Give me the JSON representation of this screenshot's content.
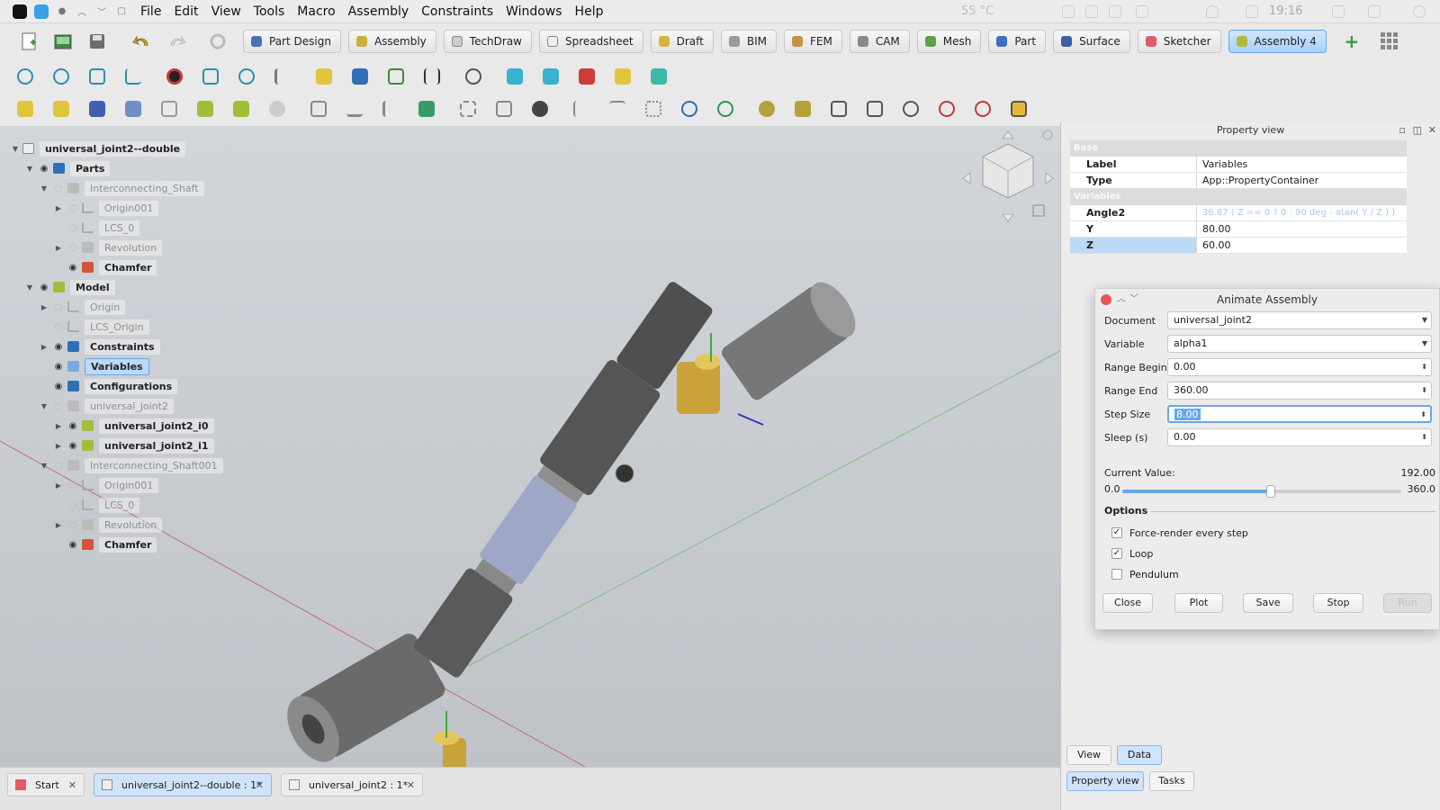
{
  "menubar": {
    "items": [
      "File",
      "Edit",
      "View",
      "Tools",
      "Macro",
      "Assembly",
      "Constraints",
      "Windows",
      "Help"
    ],
    "temperature": "55 °C",
    "time": "19:16"
  },
  "workbenches": [
    "Part Design",
    "Assembly",
    "TechDraw",
    "Spreadsheet",
    "Draft",
    "BIM",
    "FEM",
    "CAM",
    "Mesh",
    "Part",
    "Surface",
    "Sketcher",
    "Assembly 4"
  ],
  "active_workbench": "Assembly 4",
  "tree": {
    "rows": [
      {
        "label": "universal_joint2--double",
        "level": 0
      },
      {
        "label": "Parts",
        "level": 1
      },
      {
        "label": "Interconnecting_Shaft",
        "level": 2
      },
      {
        "label": "Origin001",
        "level": 3
      },
      {
        "label": "LCS_0",
        "level": 3
      },
      {
        "label": "Revolution",
        "level": 3
      },
      {
        "label": "Chamfer",
        "level": 3
      },
      {
        "label": "Model",
        "level": 1
      },
      {
        "label": "Origin",
        "level": 2
      },
      {
        "label": "LCS_Origin",
        "level": 2
      },
      {
        "label": "Constraints",
        "level": 2
      },
      {
        "label": "Variables",
        "level": 2
      },
      {
        "label": "Configurations",
        "level": 2
      },
      {
        "label": "universal_joint2",
        "level": 2
      },
      {
        "label": "universal_joint2_i0",
        "level": 3
      },
      {
        "label": "universal_joint2_i1",
        "level": 3
      },
      {
        "label": "Interconnecting_Shaft001",
        "level": 2
      },
      {
        "label": "Origin001",
        "level": 3
      },
      {
        "label": "LCS_0",
        "level": 3
      },
      {
        "label": "Revolution",
        "level": 3
      },
      {
        "label": "Chamfer",
        "level": 3
      }
    ]
  },
  "property_view": {
    "title": "Property view",
    "group_base": "Base",
    "group_variables": "Variables",
    "rows": [
      {
        "key": "Label",
        "value": "Variables"
      },
      {
        "key": "Type",
        "value": "App::PropertyContainer"
      }
    ],
    "var_rows": [
      {
        "key": "Angle2",
        "value": "36.87  ( Z == 0 ? 0 : 90 deg - atan( Y / Z ) )"
      },
      {
        "key": "Y",
        "value": "80.00"
      },
      {
        "key": "Z",
        "value": "60.00"
      }
    ]
  },
  "animate": {
    "title": "Animate Assembly",
    "document_label": "Document",
    "document_value": "universal_joint2",
    "variable_label": "Variable",
    "variable_value": "alpha1",
    "range_begin_label": "Range Begin",
    "range_begin_value": "0.00",
    "range_end_label": "Range End",
    "range_end_value": "360.00",
    "step_size_label": "Step Size",
    "step_size_value": "8.00",
    "sleep_label": "Sleep (s)",
    "sleep_value": "0.00",
    "current_value_label": "Current Value:",
    "current_value": "192.00",
    "slider_min": "0.0",
    "slider_max": "360.0",
    "slider_fraction": 0.533,
    "options_label": "Options",
    "force_render_label": "Force-render every step",
    "loop_label": "Loop",
    "pendulum_label": "Pendulum",
    "close_label": "Close",
    "plot_label": "Plot",
    "save_label": "Save",
    "stop_label": "Stop",
    "run_label": "Run"
  },
  "panel_tabs": {
    "view": "View",
    "data": "Data",
    "property_view": "Property view",
    "tasks": "Tasks"
  },
  "doc_tabs": [
    {
      "label": "Start"
    },
    {
      "label": "universal_joint2--double : 1*"
    },
    {
      "label": "universal_joint2 : 1*"
    }
  ],
  "colors": {
    "accent": "#6aa6e6",
    "selection": "#bcd9f7",
    "axis_red": "#c46b6b",
    "axis_green": "#7cc07c"
  }
}
